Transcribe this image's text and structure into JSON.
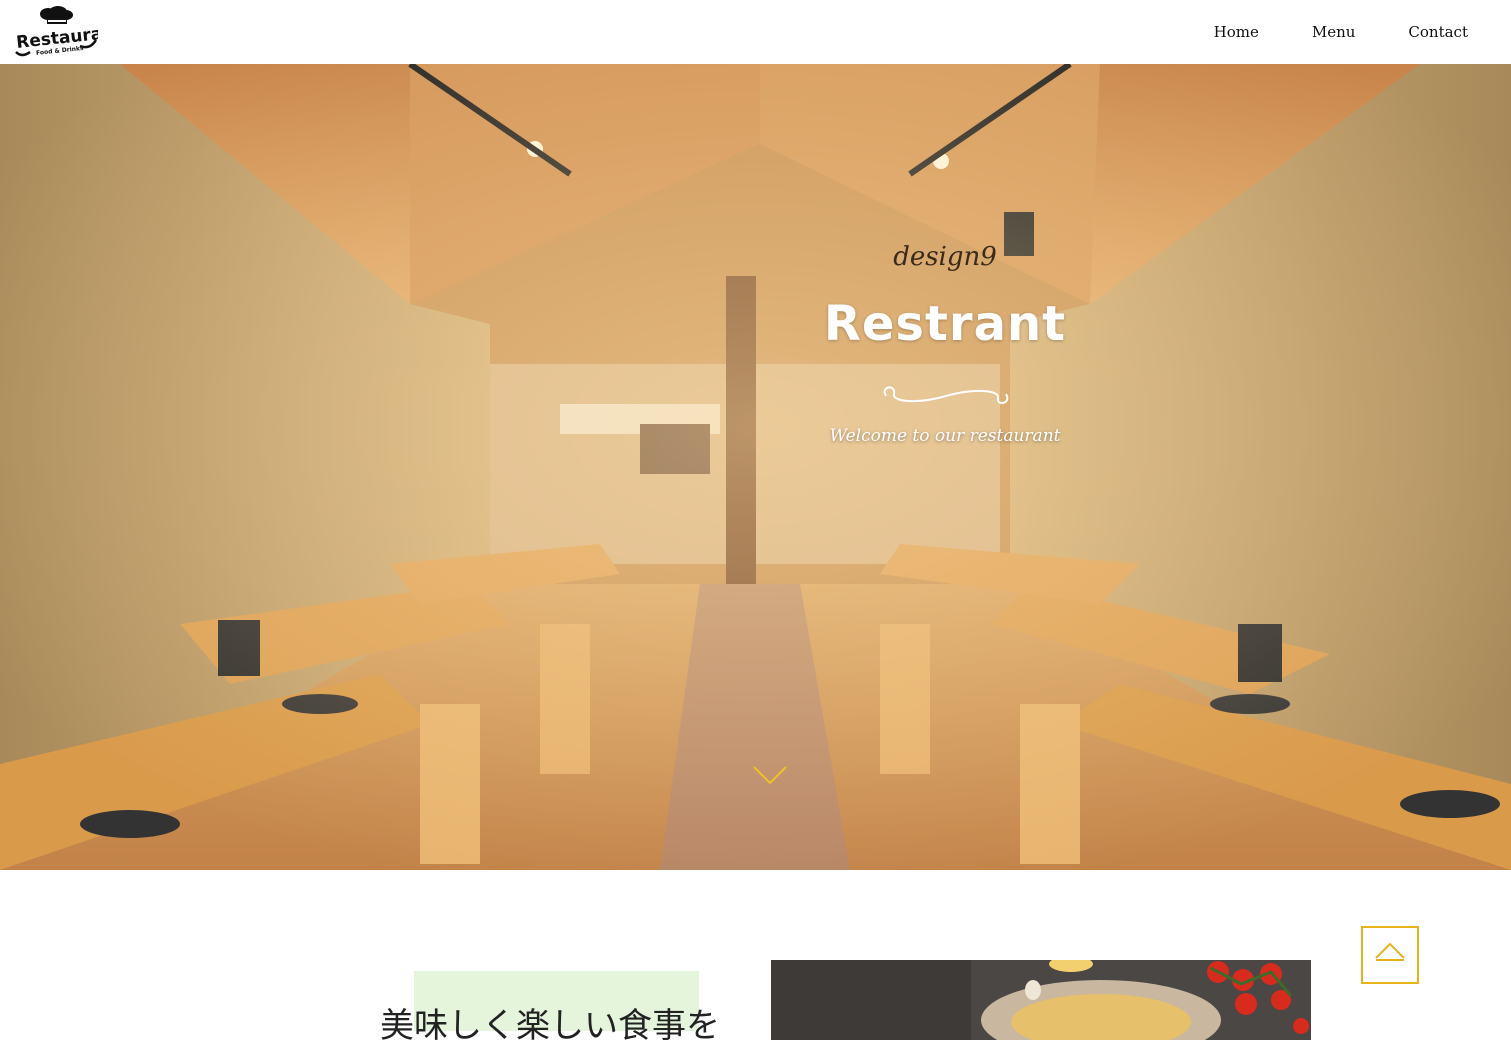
{
  "header": {
    "logo": {
      "main_text": "Restaurant",
      "sub_text": "Food & Drinks"
    },
    "nav": [
      {
        "label": "Home"
      },
      {
        "label": "Menu"
      },
      {
        "label": "Contact"
      }
    ]
  },
  "hero": {
    "tagline": "design9",
    "title": "Restrant",
    "subtitle": "Welcome to our restaurant"
  },
  "intro": {
    "heading": "美味しく楽しい食事を"
  },
  "colors": {
    "accent": "#e8b21a",
    "highlight": "#e5f5dc"
  },
  "icons": {
    "scroll": "chevron-down-icon",
    "back_to_top": "chevron-up-icon"
  }
}
